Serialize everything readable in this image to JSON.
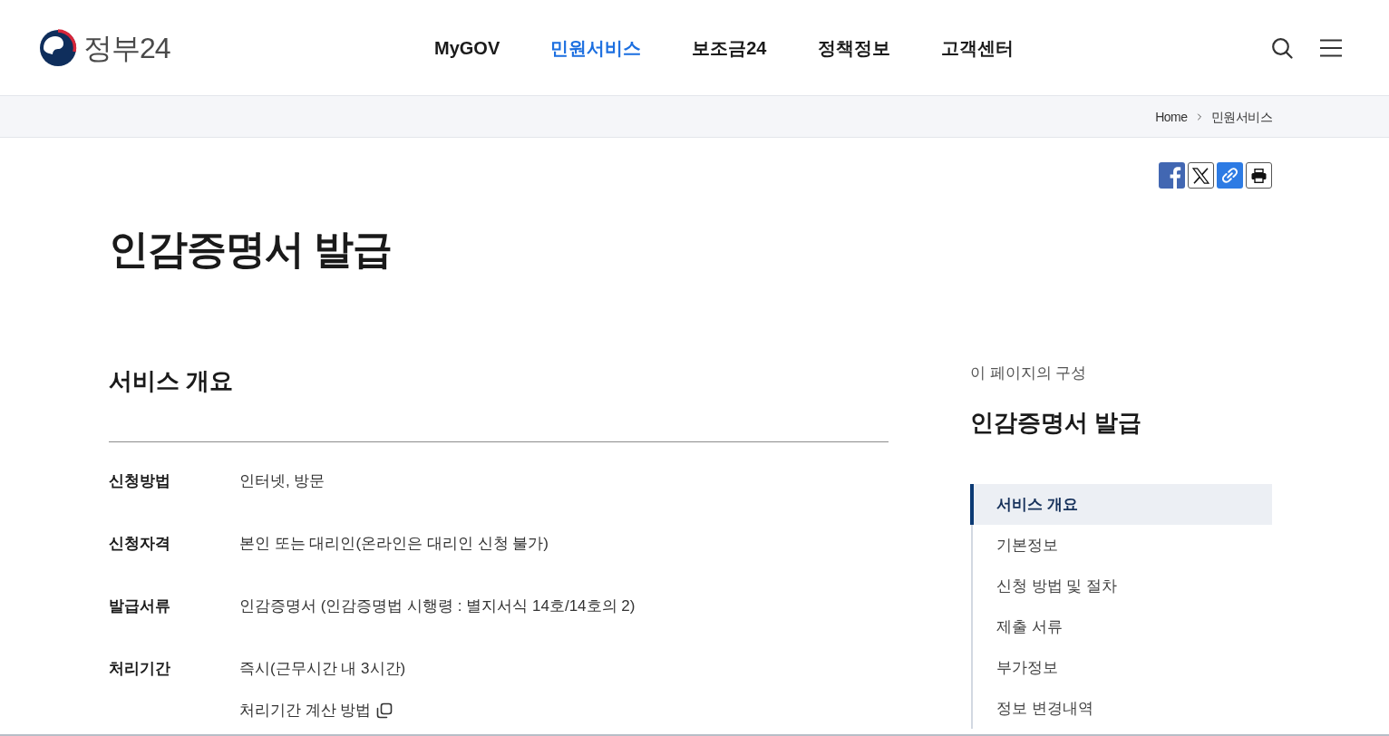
{
  "header": {
    "logo_text": "정부24",
    "nav": [
      {
        "label": "MyGOV",
        "selected": false
      },
      {
        "label": "민원서비스",
        "selected": true
      },
      {
        "label": "보조금24",
        "selected": false
      },
      {
        "label": "정책정보",
        "selected": false
      },
      {
        "label": "고객센터",
        "selected": false
      }
    ]
  },
  "breadcrumb": [
    "Home",
    "민원서비스"
  ],
  "page_title": "인감증명서 발급",
  "section": {
    "title": "서비스 개요",
    "rows": [
      {
        "label": "신청방법",
        "value": "인터넷, 방문"
      },
      {
        "label": "신청자격",
        "value": "본인 또는 대리인(온라인은 대리인 신청 불가)"
      },
      {
        "label": "발급서류",
        "value": "인감증명서 (인감증명법 시행령 : 별지서식 14호/14호의 2)"
      },
      {
        "label": "처리기간",
        "value": "즉시(근무시간 내 3시간)",
        "link": "처리기간 계산 방법"
      }
    ]
  },
  "toc": {
    "caption": "이 페이지의 구성",
    "title": "인감증명서 발급",
    "items": [
      {
        "label": "서비스 개요",
        "selected": true
      },
      {
        "label": "기본정보",
        "selected": false
      },
      {
        "label": "신청 방법 및 절차",
        "selected": false
      },
      {
        "label": "제출 서류",
        "selected": false
      },
      {
        "label": "부가정보",
        "selected": false
      },
      {
        "label": "정보 변경내역",
        "selected": false
      }
    ]
  }
}
